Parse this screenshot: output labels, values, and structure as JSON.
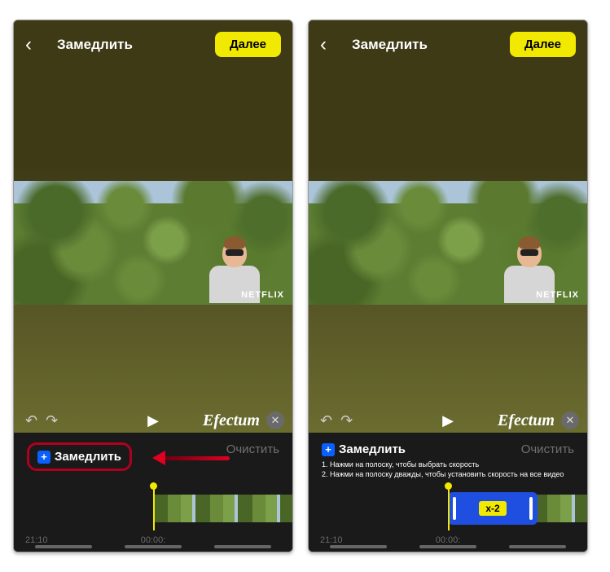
{
  "header": {
    "title": "Замедлить",
    "next": "Далее"
  },
  "watermark": "NETFLIX",
  "brand": "Efectum",
  "controls": {
    "slow": "Замедлить",
    "clear": "Очистить"
  },
  "hints": {
    "l1": "1. Нажми на полоску, чтобы выбрать скорость",
    "l2": "2. Нажми на полоску дважды, чтобы установить скорость на все видео"
  },
  "timeline": {
    "left": "21:10",
    "center": "00:00:",
    "speed": "x-2"
  }
}
